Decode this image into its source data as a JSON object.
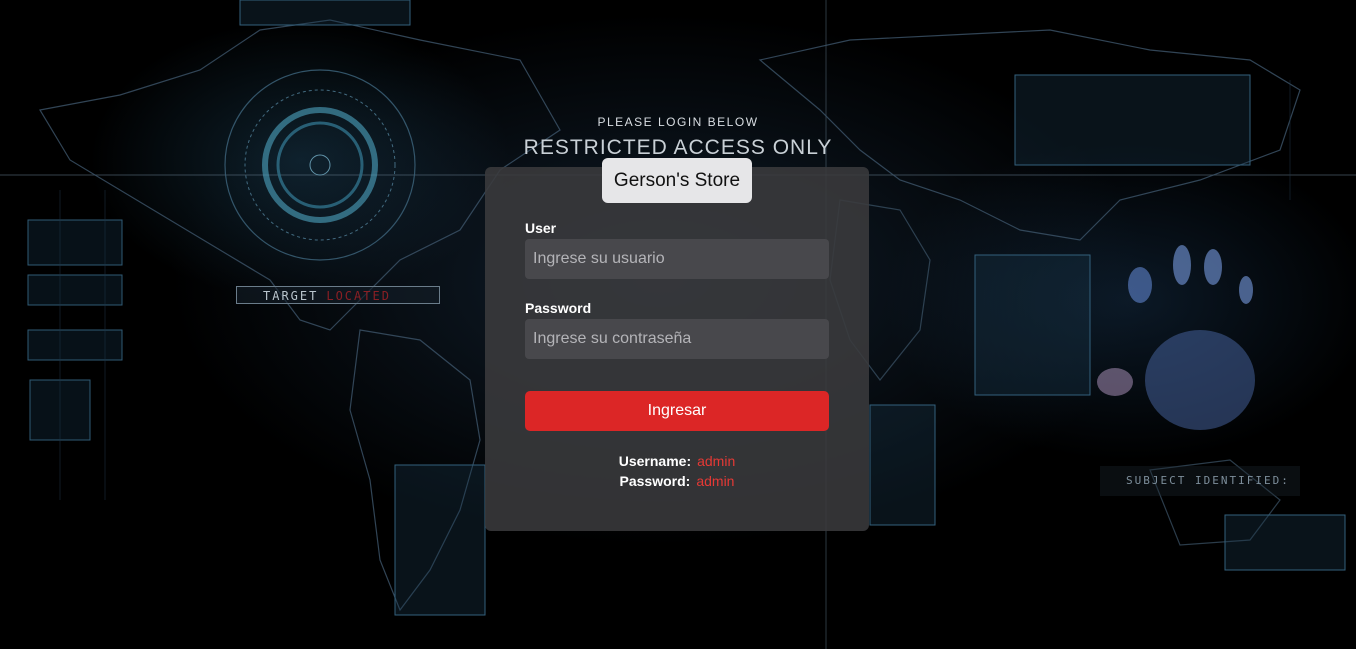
{
  "header": {
    "subtitle": "PLEASE LOGIN BELOW",
    "title": "RESTRICTED ACCESS ONLY"
  },
  "background_labels": {
    "target": "TARGET",
    "located": "LOCATED",
    "subject": "SUBJECT IDENTIFIED:"
  },
  "login": {
    "store_name": "Gerson's Store",
    "user_label": "User",
    "user_placeholder": "Ingrese su usuario",
    "password_label": "Password",
    "password_placeholder": "Ingrese su contraseña",
    "submit_label": "Ingresar"
  },
  "credentials_hint": {
    "username_label": "Username:",
    "username_value": "admin",
    "password_label": "Password:",
    "password_value": "admin"
  },
  "colors": {
    "accent": "#dc2626",
    "hint_value": "#e53935",
    "card": "#3a3a3c"
  }
}
